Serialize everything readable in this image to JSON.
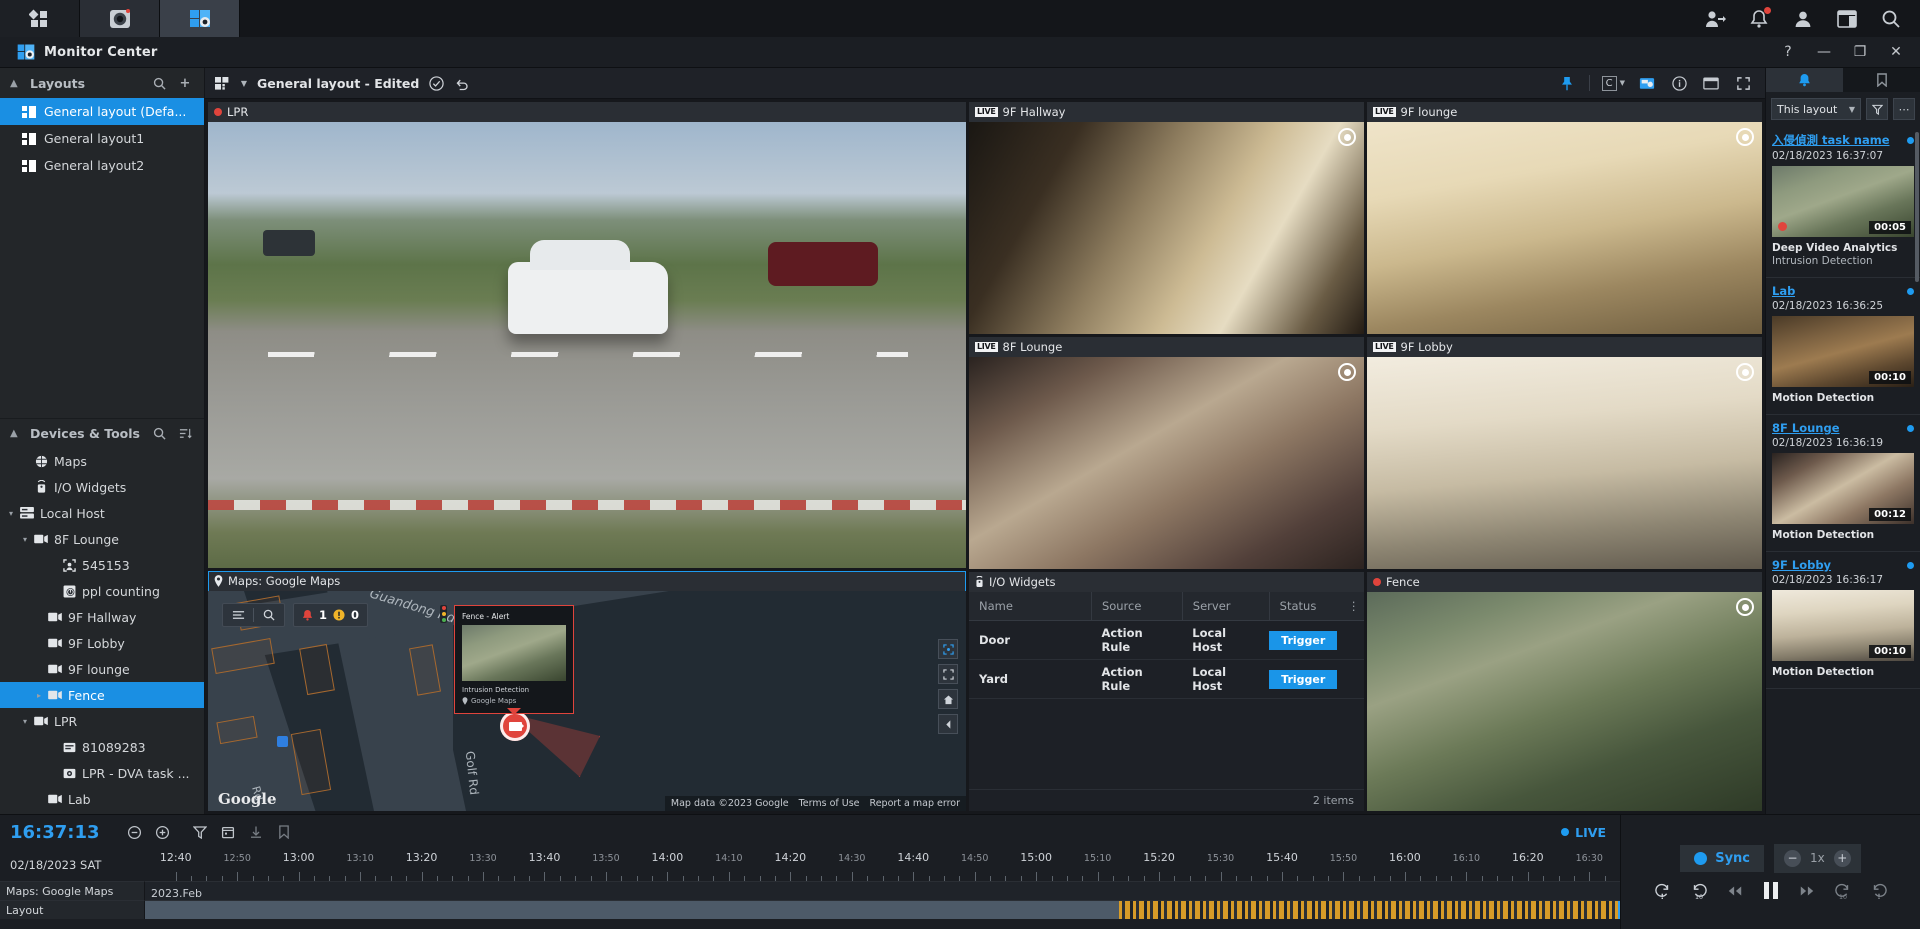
{
  "window": {
    "app_title": "Monitor Center",
    "help": "?",
    "minimize": "—",
    "maximize": "❐",
    "close": "✕"
  },
  "layouts_panel": {
    "title": "Layouts",
    "items": [
      {
        "label": "General layout (Defa..."
      },
      {
        "label": "General layout1"
      },
      {
        "label": "General layout2"
      }
    ]
  },
  "devices_panel": {
    "title": "Devices & Tools",
    "items": [
      {
        "label": "Maps",
        "icon": "globe-icon",
        "indent": 1,
        "twisty": ""
      },
      {
        "label": "I/O Widgets",
        "icon": "io-icon",
        "indent": 1,
        "twisty": ""
      },
      {
        "label": "Local Host",
        "icon": "server-icon",
        "indent": 0,
        "twisty": "▾"
      },
      {
        "label": "8F Lounge",
        "icon": "camera-icon",
        "indent": 1,
        "twisty": "▾"
      },
      {
        "label": "545153",
        "icon": "face-icon",
        "indent": 3,
        "twisty": ""
      },
      {
        "label": "ppl counting",
        "icon": "counting-icon",
        "indent": 3,
        "twisty": ""
      },
      {
        "label": "9F Hallway",
        "icon": "camera-icon",
        "indent": 2,
        "twisty": ""
      },
      {
        "label": "9F Lobby",
        "icon": "camera-icon",
        "indent": 2,
        "twisty": ""
      },
      {
        "label": "9F lounge",
        "icon": "camera-icon",
        "indent": 2,
        "twisty": ""
      },
      {
        "label": "Fence",
        "icon": "camera-icon",
        "indent": 2,
        "twisty": "▸",
        "selected": true
      },
      {
        "label": "LPR",
        "icon": "camera-icon",
        "indent": 1,
        "twisty": "▾"
      },
      {
        "label": "81089283",
        "icon": "plate-icon",
        "indent": 3,
        "twisty": ""
      },
      {
        "label": "LPR - DVA task ...",
        "icon": "dva-icon",
        "indent": 3,
        "twisty": ""
      },
      {
        "label": "Lab",
        "icon": "camera-icon",
        "indent": 2,
        "twisty": ""
      }
    ]
  },
  "layout_bar": {
    "name": "General layout - Edited",
    "confirm_icon": "check-circle-icon",
    "undo_icon": "undo-icon",
    "pin_icon": "pin-icon",
    "grid_select": "C",
    "snapshot_icon": "snapshot-icon",
    "info_icon": "info-icon",
    "window_icon": "window-icon",
    "fullscreen_icon": "fullscreen-icon"
  },
  "tiles": {
    "lpr": {
      "title": "LPR",
      "badge": "rec",
      "scene": "road"
    },
    "hallway": {
      "title": "9F Hallway",
      "badge": "LIVE",
      "scene": "hall9f"
    },
    "lounge9": {
      "title": "9F lounge",
      "badge": "LIVE",
      "scene": "lounge9f"
    },
    "lounge8": {
      "title": "8F Lounge",
      "badge": "LIVE",
      "scene": "lounge8f"
    },
    "lobby9": {
      "title": "9F Lobby",
      "badge": "LIVE",
      "scene": "lobby9f"
    },
    "fence": {
      "title": "Fence",
      "badge": "rec",
      "scene": "fencecam"
    },
    "map": {
      "title": "Maps: Google Maps",
      "alarm_count": "1",
      "warning_count": "0",
      "watermark": "Google",
      "attrib_data": "Map data ©2023 Google",
      "attrib_terms": "Terms of Use",
      "attrib_report": "Report a map error",
      "street_1": "Guandong Rd",
      "street_2": "Golf Rd",
      "street_3": "Rd",
      "popup": {
        "title": "Fence - Alert",
        "label": "Intrusion Detection",
        "source": "Google Maps"
      }
    },
    "io": {
      "title": "I/O Widgets",
      "columns": [
        "Name",
        "Source",
        "Server",
        "Status"
      ],
      "rows": [
        {
          "name": "Door",
          "source": "Action Rule",
          "server": "Local Host",
          "status": "Trigger"
        },
        {
          "name": "Yard",
          "source": "Action Rule",
          "server": "Local Host",
          "status": "Trigger"
        }
      ],
      "footer": "2 items"
    }
  },
  "events_panel": {
    "tab_alerts": "bell-icon",
    "tab_bookmarks": "bookmark-icon",
    "scope": "This layout",
    "filter_icon": "filter-icon",
    "more_icon": "more-icon",
    "events": [
      {
        "name": "入侵偵測 task name",
        "time": "02/18/2023 16:37:07",
        "duration": "00:05",
        "source": "Deep Video Analytics",
        "detail": "Intrusion Detection",
        "recording": true,
        "thumb": "evthumb1"
      },
      {
        "name": "Lab",
        "time": "02/18/2023 16:36:25",
        "duration": "00:10",
        "source": "Motion Detection",
        "detail": "",
        "recording": false,
        "thumb": "evthumb2"
      },
      {
        "name": "8F Lounge",
        "time": "02/18/2023 16:36:19",
        "duration": "00:12",
        "source": "Motion Detection",
        "detail": "",
        "recording": false,
        "thumb": "evthumb3"
      },
      {
        "name": "9F Lobby",
        "time": "02/18/2023 16:36:17",
        "duration": "00:10",
        "source": "Motion Detection",
        "detail": "",
        "recording": false,
        "thumb": "evthumb4"
      }
    ]
  },
  "timeline": {
    "clock": "16:37:13",
    "date": "02/18/2023 SAT",
    "live_label": "LIVE",
    "month_label": "2023.Feb",
    "row_labels": [
      "Maps: Google Maps",
      "Layout"
    ],
    "ticks": [
      "12:40",
      "12:50",
      "13:00",
      "13:10",
      "13:20",
      "13:30",
      "13:40",
      "13:50",
      "14:00",
      "14:10",
      "14:20",
      "14:30",
      "14:40",
      "14:50",
      "15:00",
      "15:10",
      "15:20",
      "15:30",
      "15:40",
      "15:50",
      "16:00",
      "16:10",
      "16:20",
      "16:30"
    ],
    "major_ticks": [
      "12:40",
      "13:00",
      "13:20",
      "13:40",
      "14:00",
      "14:20",
      "14:40",
      "15:00",
      "15:20",
      "15:40",
      "16:00",
      "16:20"
    ],
    "tools": [
      "zoom-out-icon",
      "zoom-in-icon",
      "filter-icon",
      "calendar-icon",
      "export-icon",
      "bookmark-icon"
    ],
    "sync_label": "Sync",
    "speed_label": "1x",
    "transport": [
      "prev-event-icon",
      "rewind-10-icon",
      "rewind-icon",
      "pause-icon",
      "forward-icon",
      "forward-10-icon",
      "next-event-icon"
    ]
  }
}
